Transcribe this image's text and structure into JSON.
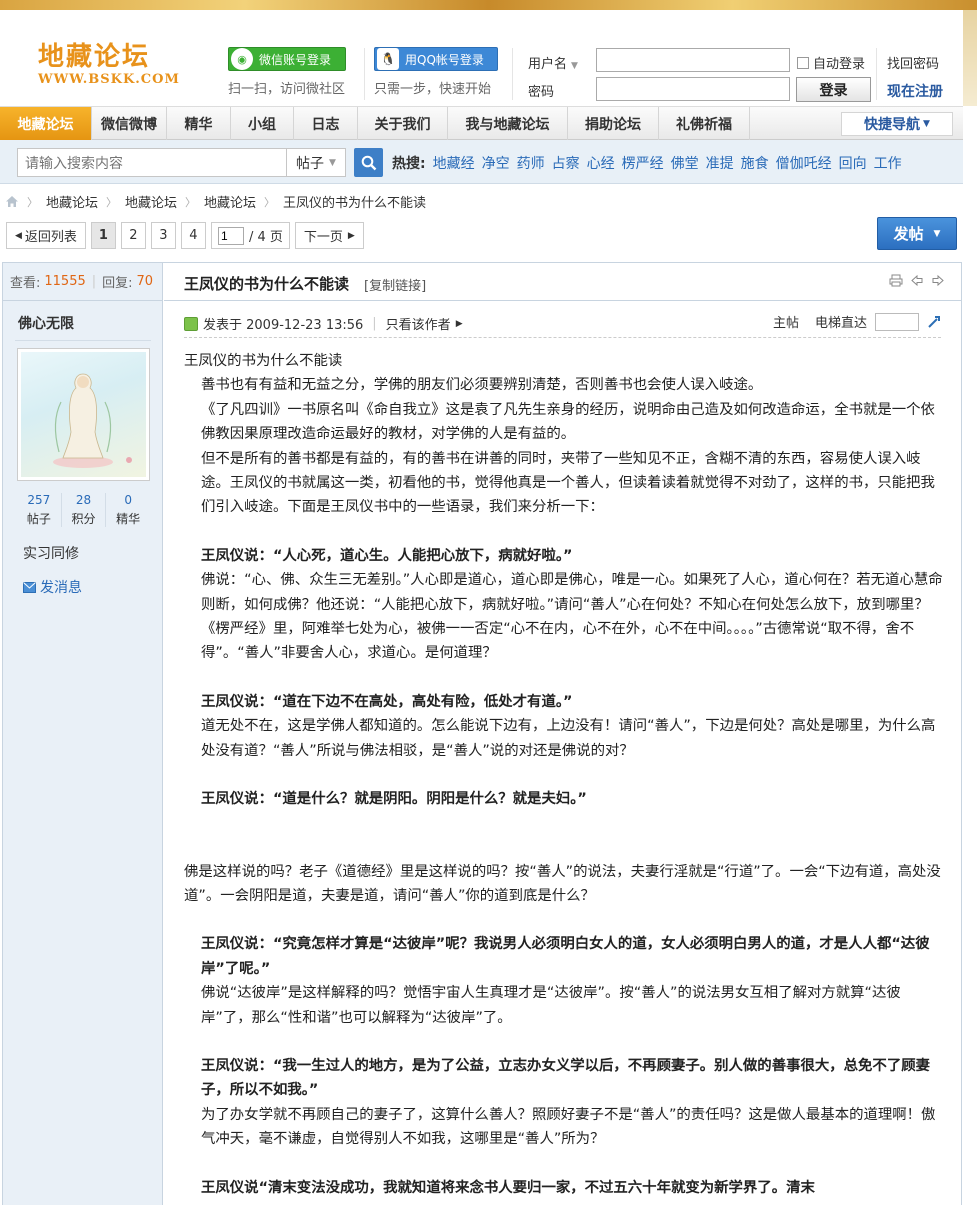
{
  "header": {
    "logo": "地藏论坛",
    "logo_url": "WWW.BSKK.COM",
    "wechat_login": "微信账号登录",
    "wechat_sub": "扫一扫，访问微社区",
    "qq_login": "用QQ帐号登录",
    "qq_sub": "只需一步，快速开始",
    "username_label": "用户名",
    "password_label": "密码",
    "auto_login": "自动登录",
    "login_button": "登录",
    "forgot_password": "找回密码",
    "register": "现在注册"
  },
  "nav": {
    "items": [
      "地藏论坛",
      "微信微博",
      "精华",
      "小组",
      "日志",
      "关于我们",
      "我与地藏论坛",
      "捐助论坛",
      "礼佛祈福"
    ],
    "quick_nav": "快捷导航"
  },
  "search": {
    "placeholder": "请输入搜索内容",
    "type": "帖子",
    "hot_label": "热搜:",
    "hot_keywords": [
      "地藏经",
      "净空",
      "药师",
      "占察",
      "心经",
      "楞严经",
      "佛堂",
      "准提",
      "施食",
      "僧伽吒经",
      "回向",
      "工作"
    ]
  },
  "breadcrumb": [
    "地藏论坛",
    "地藏论坛",
    "地藏论坛",
    "王凤仪的书为什么不能读"
  ],
  "pager": {
    "back": "返回列表",
    "pages": [
      "1",
      "2",
      "3",
      "4"
    ],
    "current": "1",
    "total": "/ 4 页",
    "next": "下一页",
    "post_button": "发帖"
  },
  "thread": {
    "views_label": "查看:",
    "views": "11555",
    "replies_label": "回复:",
    "replies": "70",
    "title": "王凤仪的书为什么不能读",
    "copy_link": "[复制链接]"
  },
  "author": {
    "name": "佛心无限",
    "stats": [
      {
        "value": "257",
        "label": "帖子"
      },
      {
        "value": "28",
        "label": "积分"
      },
      {
        "value": "0",
        "label": "精华"
      }
    ],
    "rank": "实习同修",
    "message": "发消息"
  },
  "post_meta": {
    "posted": "发表于 2009-12-23 13:56",
    "only_author": "只看该作者",
    "floor": "主帖",
    "jump": "电梯直达"
  },
  "content": {
    "p1": "王凤仪的书为什么不能读",
    "p2": "善书也有有益和无益之分，学佛的朋友们必须要辨别清楚，否则善书也会使人误入岐途。",
    "p3": "《了凡四训》一书原名叫《命自我立》这是袁了凡先生亲身的经历，说明命由己造及如何改造命运，全书就是一个依佛教因果原理改造命运最好的教材，对学佛的人是有益的。",
    "p4": "但不是所有的善书都是有益的，有的善书在讲善的同时，夹带了一些知见不正，含糊不清的东西，容易使人误入岐途。王凤仪的书就属这一类，初看他的书，觉得他真是一个善人，但读着读着就觉得不对劲了，这样的书，只能把我们引入岐途。下面是王凤仪书中的一些语录，我们来分析一下：",
    "q1": "王凤仪说：“人心死，道心生。人能把心放下，病就好啦。”",
    "a1": "佛说：“心、佛、众生三无差别。”人心即是道心，道心即是佛心，唯是一心。如果死了人心，道心何在？若无道心慧命则断，如何成佛？他还说：“人能把心放下，病就好啦。”请问“善人”心在何处？不知心在何处怎么放下，放到哪里？《楞严经》里，阿难举七处为心，被佛一一否定“心不在内，心不在外，心不在中间。。。。”古德常说“取不得，舍不得”。“善人”非要舍人心，求道心。是何道理？",
    "q2": "王凤仪说：“道在下边不在高处，高处有险，低处才有道。”",
    "a2": "道无处不在，这是学佛人都知道的。怎么能说下边有，上边没有！请问“善人”，下边是何处？高处是哪里，为什么高处没有道？“善人”所说与佛法相驳，是“善人”说的对还是佛说的对？",
    "q3": "王凤仪说：“道是什么？就是阴阳。阴阳是什么？就是夫妇。”",
    "a3": "佛是这样说的吗？老子《道德经》里是这样说的吗？按“善人”的说法，夫妻行淫就是“行道”了。一会“下边有道，高处没道”。一会阴阳是道，夫妻是道，请问“善人”你的道到底是什么？",
    "q4": "王凤仪说：“究竟怎样才算是“达彼岸”呢？我说男人必须明白女人的道，女人必须明白男人的道，才是人人都“达彼岸”了呢。”",
    "a4": "佛说“达彼岸”是这样解释的吗？觉悟宇宙人生真理才是“达彼岸”。按“善人”的说法男女互相了解对方就算“达彼岸”了，那么“性和谐”也可以解释为“达彼岸”了。",
    "q5": "王凤仪说：“我一生过人的地方，是为了公益，立志办女义学以后，不再顾妻子。别人做的善事很大，总免不了顾妻子，所以不如我。”",
    "a5": "为了办女学就不再顾自己的妻子了，这算什么善人？照顾好妻子不是“善人”的责任吗？这是做人最基本的道理啊！傲气冲天，毫不谦虚，自觉得别人不如我，这哪里是“善人”所为？",
    "q6": "王凤仪说“清末变法没成功，我就知道将来念书人要归一家，不过五六十年就变为新学界了。清末"
  }
}
